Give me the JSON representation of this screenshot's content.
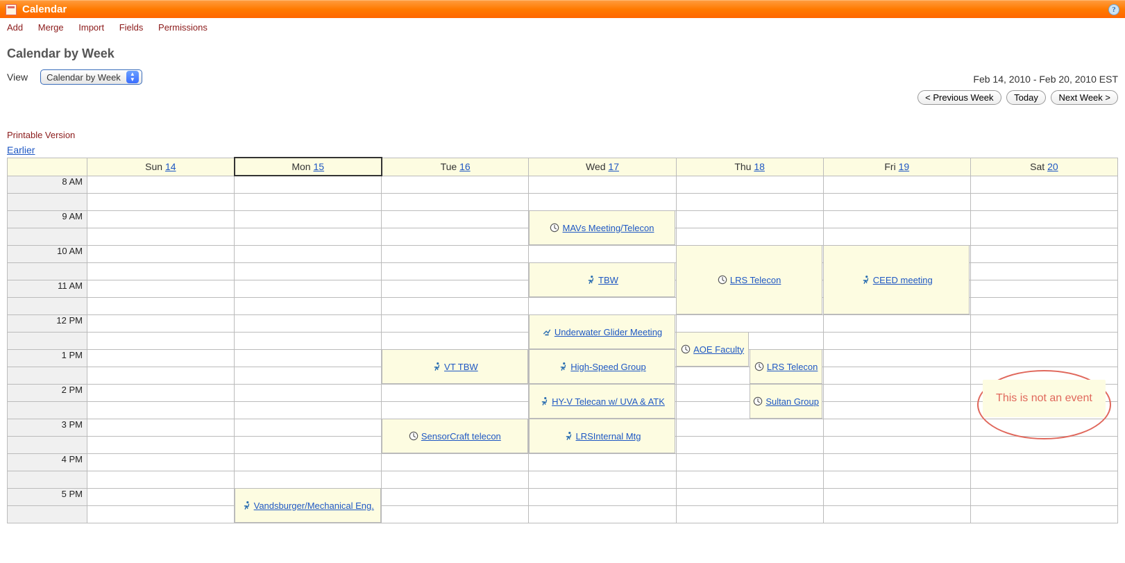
{
  "title": "Calendar",
  "actions": [
    "Add",
    "Merge",
    "Import",
    "Fields",
    "Permissions"
  ],
  "page_title": "Calendar by Week",
  "view_label": "View",
  "view_selected": "Calendar by Week",
  "date_range": "Feb 14, 2010 - Feb 20, 2010 EST",
  "nav": {
    "prev": "< Previous Week",
    "today": "Today",
    "next": "Next Week >"
  },
  "printable": "Printable Version",
  "earlier": "Earlier",
  "days": [
    {
      "short": "Sun",
      "num": "14"
    },
    {
      "short": "Mon",
      "num": "15"
    },
    {
      "short": "Tue",
      "num": "16"
    },
    {
      "short": "Wed",
      "num": "17"
    },
    {
      "short": "Thu",
      "num": "18"
    },
    {
      "short": "Fri",
      "num": "19"
    },
    {
      "short": "Sat",
      "num": "20"
    }
  ],
  "today_index": 1,
  "hours": [
    "8 AM",
    "9 AM",
    "10 AM",
    "11 AM",
    "12 PM",
    "1 PM",
    "2 PM",
    "3 PM",
    "4 PM",
    "5 PM"
  ],
  "events": [
    {
      "day": 3,
      "start": 9.0,
      "end": 10.0,
      "icon": "clock",
      "label": "MAVs Meeting/Telecon"
    },
    {
      "day": 3,
      "start": 10.5,
      "end": 11.5,
      "icon": "run",
      "label": "TBW"
    },
    {
      "day": 4,
      "start": 10.0,
      "end": 12.0,
      "icon": "clock",
      "label": "LRS Telecon"
    },
    {
      "day": 5,
      "start": 10.0,
      "end": 12.0,
      "icon": "run",
      "label": "CEED meeting"
    },
    {
      "day": 3,
      "start": 12.0,
      "end": 13.0,
      "icon": "misc",
      "label": "Underwater Glider Meeting"
    },
    {
      "day": 4,
      "start": 12.5,
      "end": 13.5,
      "icon": "clock",
      "label": "AOE Faculty",
      "half": "left"
    },
    {
      "day": 4,
      "start": 13.0,
      "end": 14.0,
      "icon": "clock",
      "label": "LRS Telecon",
      "half": "right"
    },
    {
      "day": 2,
      "start": 13.0,
      "end": 14.0,
      "icon": "run",
      "label": "VT TBW"
    },
    {
      "day": 3,
      "start": 13.0,
      "end": 14.0,
      "icon": "run",
      "label": "High-Speed Group"
    },
    {
      "day": 4,
      "start": 14.0,
      "end": 15.0,
      "icon": "clock",
      "label": "Sultan Group",
      "half": "right"
    },
    {
      "day": 3,
      "start": 14.0,
      "end": 15.0,
      "icon": "run",
      "label": "HY-V Telecan w/ UVA & ATK"
    },
    {
      "day": 2,
      "start": 15.0,
      "end": 16.0,
      "icon": "clock",
      "label": "SensorCraft telecon"
    },
    {
      "day": 3,
      "start": 15.0,
      "end": 16.0,
      "icon": "run",
      "label": "LRSInternal Mtg"
    },
    {
      "day": 1,
      "start": 17.0,
      "end": 18.0,
      "icon": "run",
      "label": "Vandsburger/Mechanical Eng."
    }
  ],
  "annotation": "This is not an event"
}
